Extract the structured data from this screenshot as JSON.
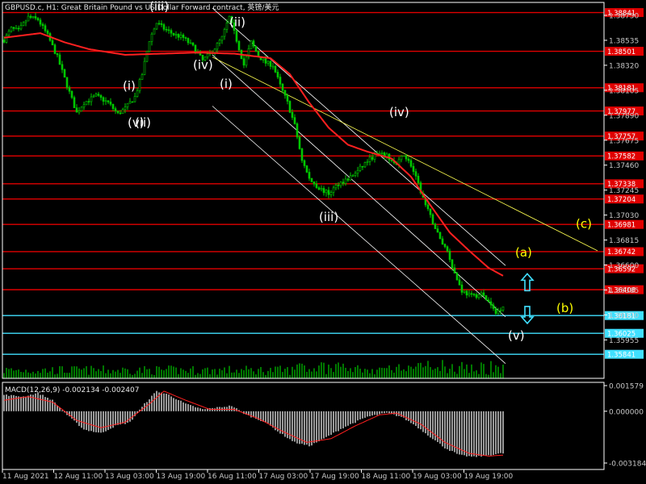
{
  "header": {
    "title": "GBPUSD.c, H1:  Great Britain Pound vs US Dollar Forward contract, 英镑/美元",
    "indicator": "MACD(12,26,9) -0.002134 -0.002407"
  },
  "colors": {
    "background": "#000000",
    "candle": "#00c800",
    "ma": "#ff2020",
    "red_level": "#e00000",
    "cyan_level": "#40e0ff",
    "channel": "#ffffff",
    "yellow_line": "#ffff50",
    "wave_white": "#ffffff",
    "wave_yellow": "#ffff00",
    "arrow": "#40e0ff",
    "volume": "#00c800",
    "macd_hist": "#c0c0c0",
    "macd_signal": "#ff2020"
  },
  "chart_data": {
    "type": "candlestick",
    "symbol": "GBPUSD.c",
    "timeframe": "H1",
    "ylim": [
      1.3563,
      1.3893
    ],
    "price_ticks": [
      "1.38750",
      "1.38535",
      "1.38320",
      "1.38105",
      "1.37890",
      "1.37675",
      "1.37460",
      "1.37245",
      "1.37030",
      "1.36815",
      "1.36600",
      "1.36385",
      "1.36170",
      "1.35955"
    ],
    "time_labels": [
      "11 Aug 2021",
      "12 Aug 11:00",
      "13 Aug 03:00",
      "13 Aug 19:00",
      "16 Aug 11:00",
      "17 Aug 03:00",
      "17 Aug 19:00",
      "18 Aug 11:00",
      "19 Aug 03:00",
      "19 Aug 19:00"
    ],
    "levels": [
      {
        "price": 1.38841,
        "label": "1.38841",
        "color": "#e00000"
      },
      {
        "price": 1.38501,
        "label": "1.38501",
        "color": "#e00000"
      },
      {
        "price": 1.38181,
        "label": "1.38181",
        "color": "#e00000"
      },
      {
        "price": 1.37977,
        "label": "1.37977",
        "color": "#e00000"
      },
      {
        "price": 1.37757,
        "label": "1.37757",
        "color": "#e00000"
      },
      {
        "price": 1.37582,
        "label": "1.37582",
        "color": "#e00000"
      },
      {
        "price": 1.37338,
        "label": "1.37338",
        "color": "#e00000"
      },
      {
        "price": 1.37204,
        "label": "1.37204",
        "color": "#e00000"
      },
      {
        "price": 1.36981,
        "label": "1.36981",
        "color": "#e00000"
      },
      {
        "price": 1.36742,
        "label": "1.36742",
        "color": "#e00000"
      },
      {
        "price": 1.36592,
        "label": "1.36592",
        "color": "#e00000"
      },
      {
        "price": 1.36408,
        "label": "1.36408",
        "color": "#e00000"
      },
      {
        "price": 1.36181,
        "label": "1.36181",
        "color": "#40e0ff"
      },
      {
        "price": 1.36025,
        "label": "1.36025",
        "color": "#40e0ff"
      },
      {
        "price": 1.35841,
        "label": "1.35841",
        "color": "#40e0ff"
      }
    ],
    "close_path": [
      [
        0,
        1.386
      ],
      [
        3,
        1.387
      ],
      [
        6,
        1.3868
      ],
      [
        10,
        1.388
      ],
      [
        14,
        1.3878
      ],
      [
        18,
        1.3864
      ],
      [
        22,
        1.3845
      ],
      [
        26,
        1.382
      ],
      [
        30,
        1.3796
      ],
      [
        33,
        1.3805
      ],
      [
        38,
        1.3811
      ],
      [
        43,
        1.3805
      ],
      [
        47,
        1.3795
      ],
      [
        50,
        1.38
      ],
      [
        54,
        1.381
      ],
      [
        57,
        1.383
      ],
      [
        60,
        1.386
      ],
      [
        63,
        1.3875
      ],
      [
        66,
        1.387
      ],
      [
        70,
        1.3865
      ],
      [
        74,
        1.3862
      ],
      [
        78,
        1.3854
      ],
      [
        82,
        1.3842
      ],
      [
        86,
        1.385
      ],
      [
        90,
        1.3862
      ],
      [
        93,
        1.388
      ],
      [
        96,
        1.386
      ],
      [
        99,
        1.3838
      ],
      [
        102,
        1.3858
      ],
      [
        105,
        1.3846
      ],
      [
        108,
        1.384
      ],
      [
        111,
        1.3838
      ],
      [
        114,
        1.382
      ],
      [
        117,
        1.3805
      ],
      [
        120,
        1.3785
      ],
      [
        123,
        1.3755
      ],
      [
        126,
        1.3738
      ],
      [
        130,
        1.373
      ],
      [
        134,
        1.3725
      ],
      [
        138,
        1.3734
      ],
      [
        142,
        1.3738
      ],
      [
        146,
        1.3745
      ],
      [
        150,
        1.3754
      ],
      [
        154,
        1.376
      ],
      [
        158,
        1.3758
      ],
      [
        162,
        1.375
      ],
      [
        165,
        1.376
      ],
      [
        168,
        1.375
      ],
      [
        171,
        1.3733
      ],
      [
        174,
        1.3715
      ],
      [
        177,
        1.37
      ],
      [
        180,
        1.3685
      ],
      [
        183,
        1.3675
      ],
      [
        186,
        1.3655
      ],
      [
        189,
        1.364
      ],
      [
        193,
        1.3635
      ],
      [
        197,
        1.3637
      ],
      [
        200,
        1.363
      ],
      [
        203,
        1.362
      ],
      [
        206,
        1.3627
      ]
    ],
    "ma_path": [
      [
        0,
        1.3862
      ],
      [
        15,
        1.3866
      ],
      [
        25,
        1.3858
      ],
      [
        35,
        1.3852
      ],
      [
        50,
        1.3847
      ],
      [
        65,
        1.3848
      ],
      [
        80,
        1.3849
      ],
      [
        95,
        1.3848
      ],
      [
        110,
        1.3844
      ],
      [
        118,
        1.383
      ],
      [
        126,
        1.3805
      ],
      [
        134,
        1.3783
      ],
      [
        142,
        1.3768
      ],
      [
        150,
        1.3762
      ],
      [
        160,
        1.3756
      ],
      [
        168,
        1.374
      ],
      [
        176,
        1.3715
      ],
      [
        184,
        1.3691
      ],
      [
        192,
        1.3675
      ],
      [
        200,
        1.366
      ],
      [
        206,
        1.3653
      ]
    ],
    "channels": [
      {
        "p1": [
          86,
          1.3888
        ],
        "p2": [
          207,
          1.3662
        ],
        "color": "#ffffff"
      },
      {
        "p1": [
          86,
          1.3847
        ],
        "p2": [
          207,
          1.3617
        ],
        "color": "#ffffff"
      },
      {
        "p1": [
          86,
          1.3802
        ],
        "p2": [
          207,
          1.3576
        ],
        "color": "#ffffff"
      },
      {
        "p1": [
          86,
          1.3845
        ],
        "p2": [
          245,
          1.3675
        ],
        "color": "#ffff50"
      }
    ],
    "wave_labels": [
      {
        "text": "(iii)",
        "bar": 60,
        "price": 1.3886,
        "color": "#ffffff"
      },
      {
        "text": "(ii)",
        "bar": 93,
        "price": 1.3872,
        "color": "#ffffff"
      },
      {
        "text": "(iv)",
        "bar": 78,
        "price": 1.38345,
        "color": "#ffffff"
      },
      {
        "text": "(i)",
        "bar": 89,
        "price": 1.3818,
        "color": "#ffffff"
      },
      {
        "text": "(i)",
        "bar": 49,
        "price": 1.3816,
        "color": "#ffffff"
      },
      {
        "text": "(v)",
        "bar": 51,
        "price": 1.3784,
        "color": "#ffffff"
      },
      {
        "text": "(ii)",
        "bar": 54,
        "price": 1.3784,
        "color": "#ffffff"
      },
      {
        "text": "(iii)",
        "bar": 130,
        "price": 1.3701,
        "color": "#ffffff"
      },
      {
        "text": "(iv)",
        "bar": 159,
        "price": 1.3793,
        "color": "#ffffff"
      },
      {
        "text": "(v)",
        "bar": 208,
        "price": 1.3597,
        "color": "#ffffff"
      },
      {
        "text": "(a)",
        "bar": 211,
        "price": 1.367,
        "color": "#ffff00"
      },
      {
        "text": "(b)",
        "bar": 228,
        "price": 1.3621,
        "color": "#ffff00"
      },
      {
        "text": "(c)",
        "bar": 236,
        "price": 1.3695,
        "color": "#ffff00"
      }
    ],
    "arrows": [
      {
        "dir": "up",
        "bar": 216,
        "price": 1.3647
      },
      {
        "dir": "down",
        "bar": 216,
        "price": 1.3619
      }
    ],
    "macd": {
      "ylim": [
        -0.003184,
        0.001579
      ],
      "ticks": [
        "0.001579",
        "0.000000",
        "-0.003184"
      ],
      "hist_path": [
        [
          0,
          0.0009
        ],
        [
          8,
          0.0008
        ],
        [
          14,
          0.001
        ],
        [
          20,
          0.0006
        ],
        [
          26,
          -0.0002
        ],
        [
          33,
          -0.001
        ],
        [
          40,
          -0.0012
        ],
        [
          46,
          -0.0008
        ],
        [
          52,
          -0.0006
        ],
        [
          58,
          0.0004
        ],
        [
          63,
          0.0011
        ],
        [
          68,
          0.0009
        ],
        [
          75,
          0.0004
        ],
        [
          82,
          0.0001
        ],
        [
          88,
          0.0002
        ],
        [
          94,
          0.0003
        ],
        [
          100,
          -0.0002
        ],
        [
          108,
          -0.0006
        ],
        [
          114,
          -0.0012
        ],
        [
          120,
          -0.0017
        ],
        [
          126,
          -0.0019
        ],
        [
          132,
          -0.0015
        ],
        [
          140,
          -0.0009
        ],
        [
          150,
          -0.0003
        ],
        [
          158,
          -0.0001
        ],
        [
          164,
          -0.0003
        ],
        [
          170,
          -0.0008
        ],
        [
          176,
          -0.0014
        ],
        [
          182,
          -0.002
        ],
        [
          188,
          -0.0024
        ],
        [
          194,
          -0.0025
        ],
        [
          200,
          -0.0024
        ],
        [
          206,
          -0.0023
        ]
      ],
      "signal_path": [
        [
          0,
          0.0006
        ],
        [
          10,
          0.0008
        ],
        [
          20,
          0.0005
        ],
        [
          30,
          -0.0005
        ],
        [
          40,
          -0.0009
        ],
        [
          50,
          -0.0006
        ],
        [
          60,
          0.0004
        ],
        [
          66,
          0.0011
        ],
        [
          75,
          0.0006
        ],
        [
          85,
          0.0001
        ],
        [
          95,
          0.0001
        ],
        [
          105,
          -0.0004
        ],
        [
          115,
          -0.0011
        ],
        [
          125,
          -0.0017
        ],
        [
          135,
          -0.0015
        ],
        [
          145,
          -0.0008
        ],
        [
          155,
          -0.0002
        ],
        [
          162,
          -0.0001
        ],
        [
          172,
          -0.0007
        ],
        [
          182,
          -0.0017
        ],
        [
          192,
          -0.0023
        ],
        [
          200,
          -0.00245
        ],
        [
          206,
          -0.0024
        ]
      ]
    }
  }
}
